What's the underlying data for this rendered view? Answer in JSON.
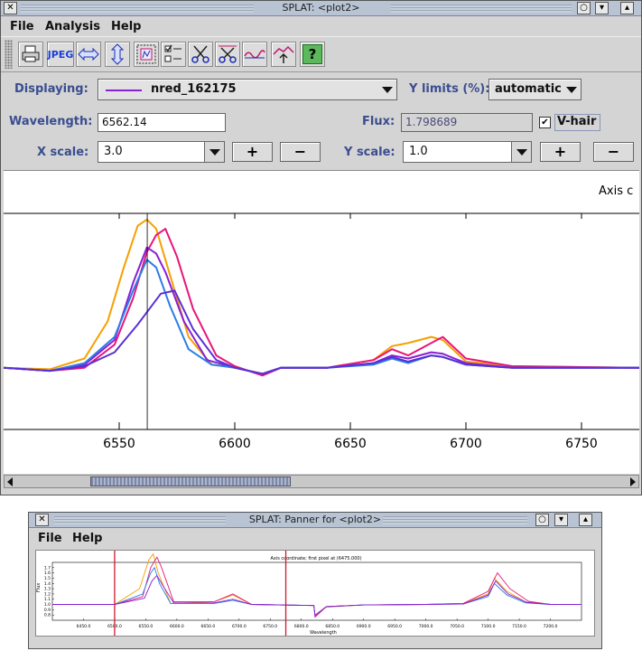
{
  "main_window": {
    "title": "SPLAT: <plot2>",
    "menu": [
      "File",
      "Analysis",
      "Help"
    ],
    "toolbar_icons": [
      "print-icon",
      "jpeg-icon",
      "fit-width-icon",
      "fit-height-icon",
      "zoom-region-icon",
      "checklist-icon",
      "cut-icon",
      "cut-region-icon",
      "line-icon",
      "baseline-icon",
      "help-icon"
    ],
    "jpeg_label": "JPEG",
    "help_glyph": "?",
    "displaying_label": "Displaying:",
    "displaying_value": "nred_162175",
    "displaying_line_color": "#8a1fd6",
    "ylimits_label": "Y limits (%):",
    "ylimits_value": "automatic",
    "wavelength_label": "Wavelength:",
    "wavelength_value": "6562.14",
    "flux_label": "Flux:",
    "flux_value": "1.798689",
    "vhair_label": "V-hair",
    "vhair_checked": true,
    "xscale_label": "X scale:",
    "xscale_value": "3.0",
    "yscale_label": "Y scale:",
    "yscale_value": "1.0",
    "plus": "+",
    "minus": "−",
    "plot_annotation": "Axis c"
  },
  "panner_window": {
    "title": "SPLAT: Panner for <plot2>",
    "menu": [
      "File",
      "Help"
    ]
  },
  "chart_data": [
    {
      "type": "line",
      "title": "",
      "xlabel": "",
      "ylabel": "",
      "xlim": [
        6500,
        6775
      ],
      "x_ticks": [
        6550,
        6600,
        6650,
        6700,
        6750
      ],
      "cursor_x": 6562.14,
      "series": [
        {
          "color": "#f5a000",
          "x": [
            6500,
            6520,
            6535,
            6545,
            6552,
            6558,
            6562,
            6566,
            6572,
            6580,
            6590,
            6600,
            6612,
            6620,
            6640,
            6660,
            6668,
            6675,
            6685,
            6690,
            6700,
            6720,
            6775
          ],
          "y": [
            1.0,
            0.99,
            1.06,
            1.3,
            1.65,
            1.92,
            1.96,
            1.9,
            1.6,
            1.2,
            1.02,
            1.0,
            0.96,
            1.0,
            1.0,
            1.05,
            1.14,
            1.16,
            1.2,
            1.18,
            1.04,
            1.01,
            1.0
          ]
        },
        {
          "color": "#e8157a",
          "x": [
            6500,
            6520,
            6535,
            6548,
            6556,
            6562,
            6566,
            6570,
            6575,
            6582,
            6592,
            6600,
            6612,
            6620,
            6640,
            6660,
            6668,
            6675,
            6685,
            6690,
            6700,
            6720,
            6775
          ],
          "y": [
            1.0,
            0.98,
            1.0,
            1.15,
            1.45,
            1.75,
            1.86,
            1.9,
            1.72,
            1.38,
            1.08,
            1.01,
            0.95,
            1.0,
            1.0,
            1.05,
            1.12,
            1.08,
            1.16,
            1.2,
            1.06,
            1.01,
            1.0
          ]
        },
        {
          "color": "#8a1fd6",
          "x": [
            6500,
            6520,
            6535,
            6548,
            6556,
            6562,
            6566,
            6570,
            6578,
            6588,
            6600,
            6612,
            6620,
            6640,
            6660,
            6668,
            6675,
            6685,
            6690,
            6700,
            6720,
            6775
          ],
          "y": [
            1.0,
            0.98,
            1.02,
            1.18,
            1.55,
            1.78,
            1.74,
            1.62,
            1.3,
            1.05,
            1.0,
            0.96,
            1.0,
            1.0,
            1.03,
            1.08,
            1.06,
            1.1,
            1.09,
            1.03,
            1.0,
            1.0
          ]
        },
        {
          "color": "#2a7de8",
          "x": [
            6500,
            6520,
            6535,
            6548,
            6556,
            6562,
            6566,
            6572,
            6580,
            6590,
            6600,
            6612,
            6620,
            6640,
            6660,
            6668,
            6675,
            6685,
            6690,
            6700,
            6720,
            6775
          ],
          "y": [
            1.0,
            0.98,
            1.03,
            1.2,
            1.5,
            1.7,
            1.65,
            1.4,
            1.12,
            1.02,
            1.0,
            0.96,
            1.0,
            1.0,
            1.02,
            1.06,
            1.03,
            1.08,
            1.07,
            1.02,
            1.0,
            1.0
          ]
        },
        {
          "color": "#5a2fd6",
          "x": [
            6500,
            6520,
            6535,
            6548,
            6558,
            6562,
            6568,
            6574,
            6582,
            6592,
            6600,
            6612,
            6620,
            6640,
            6660,
            6668,
            6675,
            6685,
            6690,
            6700,
            6720,
            6775
          ],
          "y": [
            1.0,
            0.98,
            1.01,
            1.1,
            1.28,
            1.36,
            1.48,
            1.5,
            1.25,
            1.05,
            1.0,
            0.96,
            1.0,
            1.0,
            1.03,
            1.07,
            1.04,
            1.08,
            1.07,
            1.02,
            1.0,
            1.0
          ]
        }
      ]
    },
    {
      "type": "line",
      "title": "Axis coordinate; first pixel at (6475.000)",
      "xlabel": "Wavelength",
      "ylabel": "Flux",
      "xlim": [
        6400,
        7250
      ],
      "x_ticks": [
        6450,
        6500,
        6550,
        6600,
        6650,
        6700,
        6750,
        6800,
        6850,
        6900,
        6950,
        7000,
        7050,
        7100,
        7150,
        7200
      ],
      "y_ticks": [
        0.8,
        0.9,
        1.0,
        1.1,
        1.2,
        1.3,
        1.4,
        1.5,
        1.6,
        1.7
      ],
      "view_window_x": [
        6500,
        6775
      ],
      "series": [
        {
          "color": "#f5a000",
          "x": [
            6400,
            6500,
            6540,
            6555,
            6562,
            6570,
            6590,
            6660,
            6690,
            6720,
            6820,
            6822,
            6840,
            6900,
            7000,
            7060,
            7100,
            7110,
            7130,
            7160,
            7200,
            7250
          ],
          "y": [
            1.0,
            1.0,
            1.3,
            1.85,
            1.96,
            1.6,
            1.02,
            1.05,
            1.18,
            1.0,
            0.98,
            0.78,
            0.95,
            0.99,
            1.0,
            1.02,
            1.2,
            1.5,
            1.25,
            1.05,
            1.0,
            1.0
          ]
        },
        {
          "color": "#e8157a",
          "x": [
            6400,
            6500,
            6545,
            6558,
            6568,
            6575,
            6595,
            6660,
            6690,
            6720,
            6820,
            6822,
            6840,
            6900,
            7000,
            7060,
            7100,
            7115,
            7135,
            7165,
            7200,
            7250
          ],
          "y": [
            1.0,
            1.0,
            1.15,
            1.7,
            1.9,
            1.72,
            1.05,
            1.05,
            1.2,
            1.0,
            0.98,
            0.76,
            0.96,
            0.99,
            1.0,
            1.02,
            1.25,
            1.6,
            1.3,
            1.06,
            1.0,
            1.0
          ]
        },
        {
          "color": "#2a7de8",
          "x": [
            6400,
            6500,
            6545,
            6558,
            6564,
            6572,
            6590,
            6660,
            6690,
            6720,
            6820,
            6822,
            6840,
            6900,
            7000,
            7060,
            7100,
            7110,
            7130,
            7160,
            7200,
            7250
          ],
          "y": [
            1.0,
            1.0,
            1.2,
            1.6,
            1.7,
            1.4,
            1.02,
            1.02,
            1.08,
            1.0,
            0.98,
            0.8,
            0.96,
            0.99,
            1.0,
            1.01,
            1.15,
            1.4,
            1.18,
            1.03,
            1.0,
            1.0
          ]
        },
        {
          "color": "#8a1fd6",
          "x": [
            6400,
            6500,
            6548,
            6560,
            6568,
            6578,
            6595,
            6660,
            6690,
            6720,
            6820,
            6822,
            6840,
            6900,
            7000,
            7060,
            7100,
            7112,
            7132,
            7162,
            7200,
            7250
          ],
          "y": [
            1.0,
            1.0,
            1.12,
            1.45,
            1.55,
            1.35,
            1.03,
            1.03,
            1.1,
            1.0,
            0.98,
            0.79,
            0.96,
            0.99,
            1.0,
            1.01,
            1.18,
            1.45,
            1.2,
            1.04,
            1.0,
            1.0
          ]
        }
      ]
    }
  ]
}
